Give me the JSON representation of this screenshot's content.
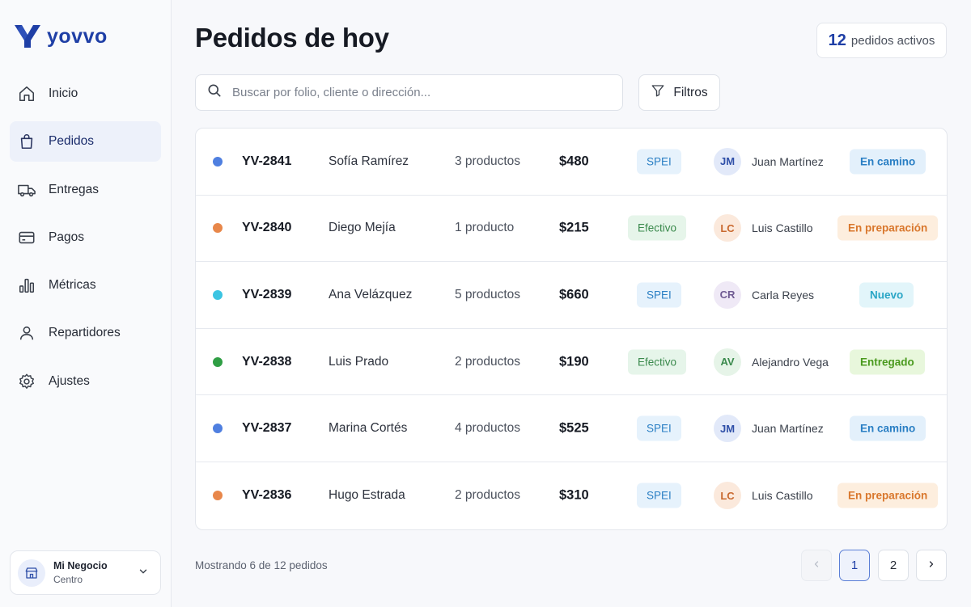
{
  "brand": {
    "name": "yovvo",
    "color": "#1f3fa6"
  },
  "sidebar": {
    "items": [
      {
        "label": "Inicio",
        "icon": "home-icon",
        "active": false
      },
      {
        "label": "Pedidos",
        "icon": "shopping-bag-icon",
        "active": true
      },
      {
        "label": "Entregas",
        "icon": "truck-icon",
        "active": false
      },
      {
        "label": "Pagos",
        "icon": "credit-card-icon",
        "active": false
      },
      {
        "label": "Métricas",
        "icon": "bar-chart-icon",
        "active": false
      },
      {
        "label": "Repartidores",
        "icon": "user-icon",
        "active": false
      },
      {
        "label": "Ajustes",
        "icon": "gear-icon",
        "active": false
      }
    ],
    "business": {
      "name": "Mi Negocio",
      "branch": "Centro",
      "icon": "store-icon"
    }
  },
  "header": {
    "title": "Pedidos de hoy",
    "active_count": "12",
    "active_label": "pedidos activos"
  },
  "search": {
    "placeholder": "Buscar por folio, cliente o dirección...",
    "value": ""
  },
  "filters": {
    "label": "Filtros",
    "icon": "filter-icon"
  },
  "orders": [
    {
      "dot_color": "#4f7fe0",
      "folio": "YV-2841",
      "client": "Sofía Ramírez",
      "products": "3 productos",
      "amount": "$480",
      "payment": "SPEI",
      "payment_type": "spei",
      "initials": "JM",
      "courier": "Juan Martínez",
      "avatar_bg": "#e2e9f9",
      "avatar_fg": "#2f4fa8",
      "status": "En camino",
      "status_bg": "#e3f0fb",
      "status_fg": "#2a7fc4"
    },
    {
      "dot_color": "#e8874a",
      "folio": "YV-2840",
      "client": "Diego Mejía",
      "products": "1 producto",
      "amount": "$215",
      "payment": "Efectivo",
      "payment_type": "cash",
      "initials": "LC",
      "courier": "Luis Castillo",
      "avatar_bg": "#fbe9dc",
      "avatar_fg": "#c9692f",
      "status": "En preparación",
      "status_bg": "#fdeede",
      "status_fg": "#d9772c"
    },
    {
      "dot_color": "#3cc4e2",
      "folio": "YV-2839",
      "client": "Ana Velázquez",
      "products": "5 productos",
      "amount": "$660",
      "payment": "SPEI",
      "payment_type": "spei",
      "initials": "CR",
      "courier": "Carla Reyes",
      "avatar_bg": "#efe9f6",
      "avatar_fg": "#6f5a92",
      "status": "Nuevo",
      "status_bg": "#e2f5fa",
      "status_fg": "#2aa6c6"
    },
    {
      "dot_color": "#2f9e44",
      "folio": "YV-2838",
      "client": "Luis Prado",
      "products": "2 productos",
      "amount": "$190",
      "payment": "Efectivo",
      "payment_type": "cash",
      "initials": "AV",
      "courier": "Alejandro Vega",
      "avatar_bg": "#e6f4e8",
      "avatar_fg": "#3b8a4d",
      "status": "Entregado",
      "status_bg": "#e8f7dc",
      "status_fg": "#4a9a1e"
    },
    {
      "dot_color": "#4f7fe0",
      "folio": "YV-2837",
      "client": "Marina Cortés",
      "products": "4 productos",
      "amount": "$525",
      "payment": "SPEI",
      "payment_type": "spei",
      "initials": "JM",
      "courier": "Juan Martínez",
      "avatar_bg": "#e2e9f9",
      "avatar_fg": "#2f4fa8",
      "status": "En camino",
      "status_bg": "#e3f0fb",
      "status_fg": "#2a7fc4"
    },
    {
      "dot_color": "#e8874a",
      "folio": "YV-2836",
      "client": "Hugo Estrada",
      "products": "2 productos",
      "amount": "$310",
      "payment": "SPEI",
      "payment_type": "spei",
      "initials": "LC",
      "courier": "Luis Castillo",
      "avatar_bg": "#fbe9dc",
      "avatar_fg": "#c9692f",
      "status": "En preparación",
      "status_bg": "#fdeede",
      "status_fg": "#d9772c"
    }
  ],
  "footer": {
    "showing": "Mostrando 6 de 12 pedidos",
    "pages": [
      "1",
      "2"
    ],
    "current_page": "1"
  }
}
